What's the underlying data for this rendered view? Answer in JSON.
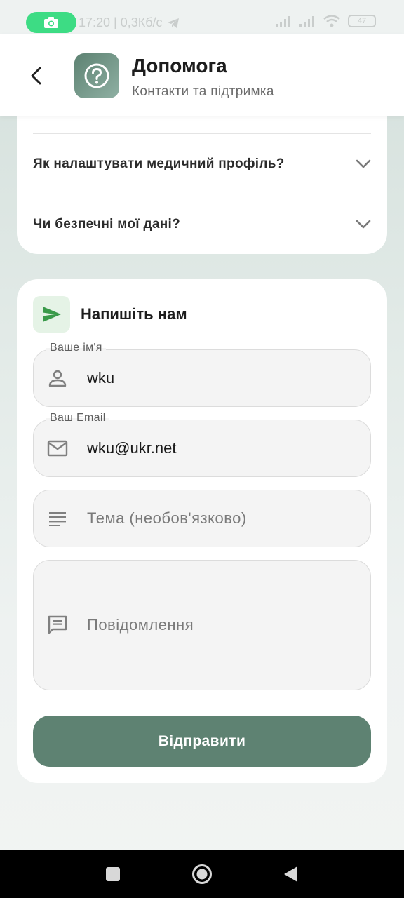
{
  "status_bar": {
    "time_text": "17:20 | 0,3Кб/с",
    "battery": "47"
  },
  "header": {
    "title": "Допомога",
    "subtitle": "Контакти та підтримка"
  },
  "faq": {
    "items": [
      {
        "question": "Як налаштувати медичний профіль?"
      },
      {
        "question": "Чи безпечні мої дані?"
      }
    ]
  },
  "contact": {
    "title": "Напишіть нам",
    "name_field": {
      "label": "Ваше ім'я",
      "value": "wku"
    },
    "email_field": {
      "label": "Ваш Email",
      "value": "wku@ukr.net"
    },
    "subject_field": {
      "placeholder": "Тема (необов'язково)"
    },
    "message_field": {
      "placeholder": "Повідомлення"
    },
    "submit_label": "Відправити"
  },
  "colors": {
    "accent": "#5e8272",
    "send_icon": "#3a9a4a",
    "icon_grey": "#808080"
  },
  "icons": {
    "back": "arrow-back-icon",
    "help": "help-circle-icon",
    "send": "send-icon",
    "person": "person-icon",
    "mail": "mail-icon",
    "subject": "subject-lines-icon",
    "message": "message-icon"
  }
}
